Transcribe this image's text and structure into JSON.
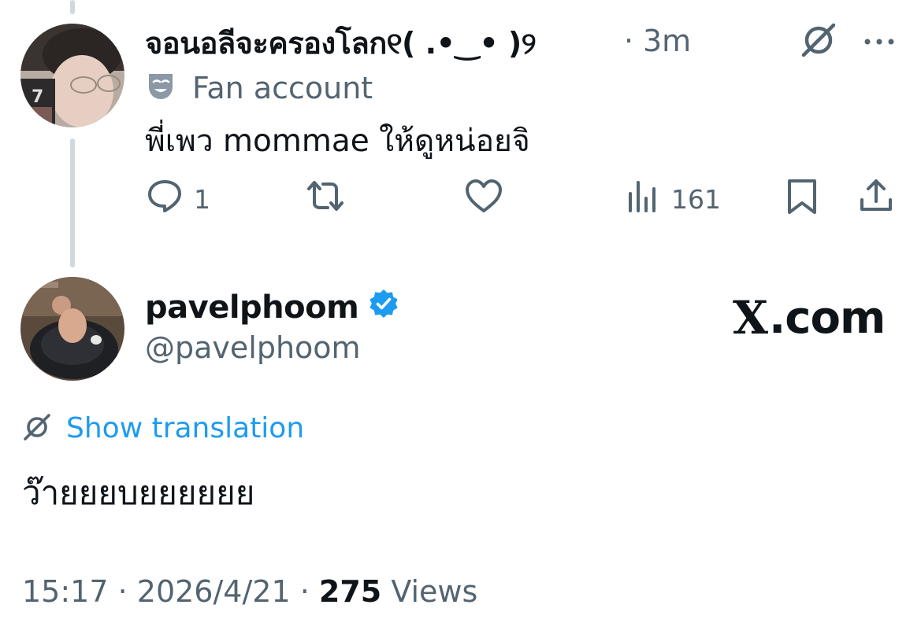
{
  "reply_tweet": {
    "display_name": "จอนอลีจะครองโลก୧( .•‿• )୨",
    "separator": "·",
    "time_ago": "3m",
    "badge_label": "Fan account",
    "text": "พี่เพว mommae ให้ดูหน่อยจิ",
    "actions": {
      "reply_count": "1",
      "retweet_count": "",
      "like_count": "",
      "views_count": "161"
    },
    "icons": [
      "grok-icon",
      "more-icon",
      "drama-mask-icon",
      "reply-icon",
      "retweet-icon",
      "like-icon",
      "views-icon",
      "bookmark-icon",
      "share-icon"
    ]
  },
  "main_tweet": {
    "display_name": "pavelphoom",
    "handle": "@pavelphoom",
    "verified": true,
    "platform_label": ".com",
    "platform_logo": "X",
    "translate_label": "Show translation",
    "text": "ว๊ายยยบยยยยยย",
    "time": "15:17",
    "date": "2026/4/21",
    "views_count": "275",
    "views_label": "Views"
  },
  "colors": {
    "text_primary": "#0f1419",
    "text_secondary": "#536471",
    "accent": "#1d9bf0",
    "thread_line": "#cfd9de"
  }
}
